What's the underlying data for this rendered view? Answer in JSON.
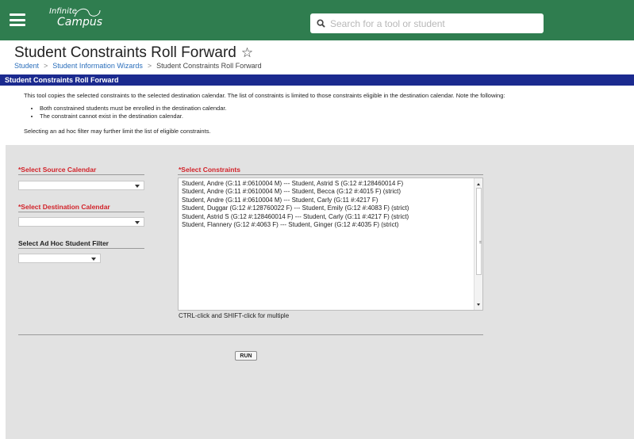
{
  "app": {
    "logo_line1": "Infinite",
    "logo_line2": "Campus",
    "search_placeholder": "Search for a tool or student",
    "brand_color": "#2f7d4f"
  },
  "header": {
    "title": "Student Constraints Roll Forward",
    "breadcrumb": [
      "Student",
      "Student Information Wizards",
      "Student Constraints Roll Forward"
    ]
  },
  "section_bar": "Student Constraints Roll Forward",
  "description": {
    "intro": "This tool copies the selected constraints to the selected destination calendar. The list of constraints is limited to those constraints eligible in the destination calendar. Note the following:",
    "bullets": [
      "Both constrained students must be enrolled in the destination calendar.",
      "The constraint cannot exist in the destination calendar."
    ],
    "footer": "Selecting an ad hoc filter may further limit the list of eligible constraints."
  },
  "form": {
    "source_label": "*Select Source Calendar",
    "source_value": "",
    "destination_label": "*Select Destination Calendar",
    "destination_value": "",
    "filter_label": "Select Ad Hoc Student Filter",
    "filter_value": "",
    "constraints_label": "*Select Constraints",
    "constraints": [
      "Student, Andre (G:11 #:0610004 M) --- Student, Astrid S (G:12 #:128460014 F)",
      "Student, Andre (G:11 #:0610004 M) --- Student, Becca (G:12 #:4015 F) (strict)",
      "Student, Andre (G:11 #:0610004 M) --- Student, Carly (G:11 #:4217 F)",
      "Student, Duggar (G:12 #:128760022 F) --- Student, Emily (G:12 #:4083 F) (strict)",
      "Student, Astrid S (G:12 #:128460014 F) --- Student, Carly (G:11 #:4217 F) (strict)",
      "Student, Flannery (G:12 #:4063 F) --- Student, Ginger (G:12 #:4035 F) (strict)"
    ],
    "hint": "CTRL-click and SHIFT-click for multiple",
    "run_label": "RUN"
  },
  "icons": {
    "menu": "hamburger-icon",
    "search": "search-icon",
    "favorite": "star-outline-icon"
  },
  "colors": {
    "section_bar": "#1b2a8f",
    "required_label": "#d2232a",
    "link": "#2a6ebb"
  }
}
